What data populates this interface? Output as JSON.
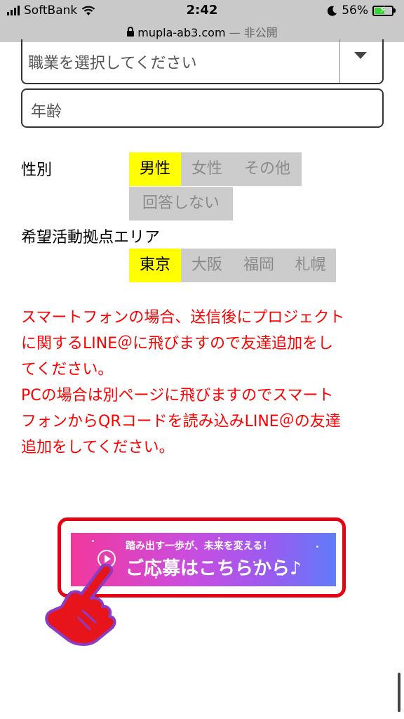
{
  "status_bar": {
    "carrier": "SoftBank",
    "time": "2:42",
    "battery_percent": "56%",
    "url": "mupla-ab3.com",
    "url_suffix": "— 非公開"
  },
  "form": {
    "occupation_placeholder": "職業を選択してください",
    "age_placeholder": "年齢",
    "gender": {
      "label": "性別",
      "options": [
        "男性",
        "女性",
        "その他",
        "回答しない"
      ],
      "selected": "男性"
    },
    "area": {
      "label": "希望活動拠点エリア",
      "options": [
        "東京",
        "大阪",
        "福岡",
        "札幌"
      ],
      "selected": "東京"
    }
  },
  "notice": {
    "lines": [
      "スマートフォンの場合、送信後にプロジェクト",
      "に関するLINE＠に飛びますので友達追加をし",
      "てください。",
      "PCの場合は別ページに飛びますのでスマート",
      "フォンからQRコードを読み込みLINE＠の友達",
      "追加をしてください。"
    ],
    "color": "#ff0000"
  },
  "cta_banner": {
    "tagline": "踏み出す一歩が、未来を変える！",
    "label": "ご応募はこちらから♪",
    "border_color": "#e60012"
  },
  "icons": [
    "signal-icon",
    "wifi-icon",
    "moon-icon",
    "battery-icon",
    "lock-icon",
    "chevron-down-icon",
    "play-icon",
    "pointing-hand-icon"
  ]
}
